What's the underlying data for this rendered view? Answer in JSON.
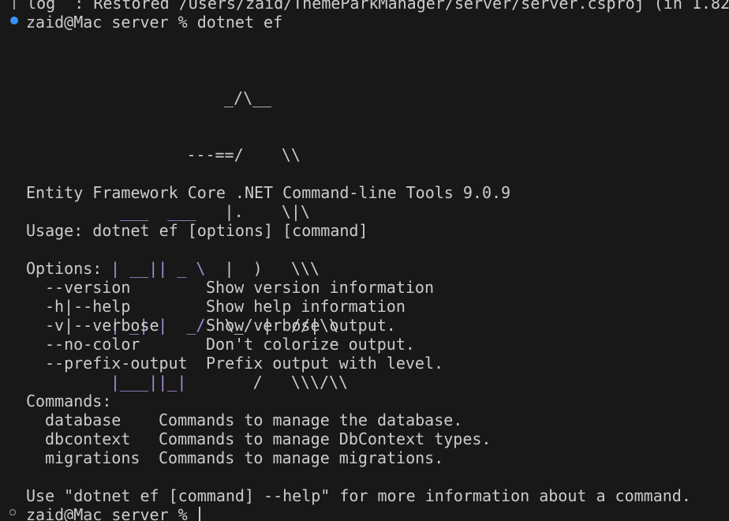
{
  "terminal": {
    "previous_output": " log  : Restored /Users/zaid/ThemeParkManager/server/server.csproj (in 1.82",
    "prompt_user_host": "zaid@Mac server %",
    "command": "dotnet ef",
    "logo": {
      "r1": "                ",
      "r1b": "_/\\__",
      "r2a": "         ---==/    \\\\",
      "r3p": "  ___  ___",
      "r3w": "   |.    \\|\\",
      "r4p": " | __|| _ \\",
      "r4w": "  |  )   \\\\\\",
      "r5p": " | _| |  _/",
      "r5w": "  \\_/ |  //|\\\\",
      "r6p": " |___||_|",
      "r6w": "       /   \\\\\\/\\\\"
    },
    "title_line": "Entity Framework Core .NET Command-line Tools 9.0.9",
    "usage_line": "Usage: dotnet ef [options] [command]",
    "options_header": "Options:",
    "options": [
      {
        "flag": "--version",
        "desc": "Show version information"
      },
      {
        "flag": "-h|--help",
        "desc": "Show help information"
      },
      {
        "flag": "-v|--verbose",
        "desc": "Show verbose output."
      },
      {
        "flag": "--no-color",
        "desc": "Don't colorize output."
      },
      {
        "flag": "--prefix-output",
        "desc": "Prefix output with level."
      }
    ],
    "commands_header": "Commands:",
    "commands": [
      {
        "name": "database",
        "desc": "Commands to manage the database."
      },
      {
        "name": "dbcontext",
        "desc": "Commands to manage DbContext types."
      },
      {
        "name": "migrations",
        "desc": "Commands to manage migrations."
      }
    ],
    "footer_line": "Use \"dotnet ef [command] --help\" for more information about a command.",
    "final_prompt": "zaid@Mac server %"
  },
  "colors": {
    "background": "#181818",
    "text": "#cccccc",
    "logo_accent": "#a98bd9",
    "status_dot": "#3794ff"
  }
}
